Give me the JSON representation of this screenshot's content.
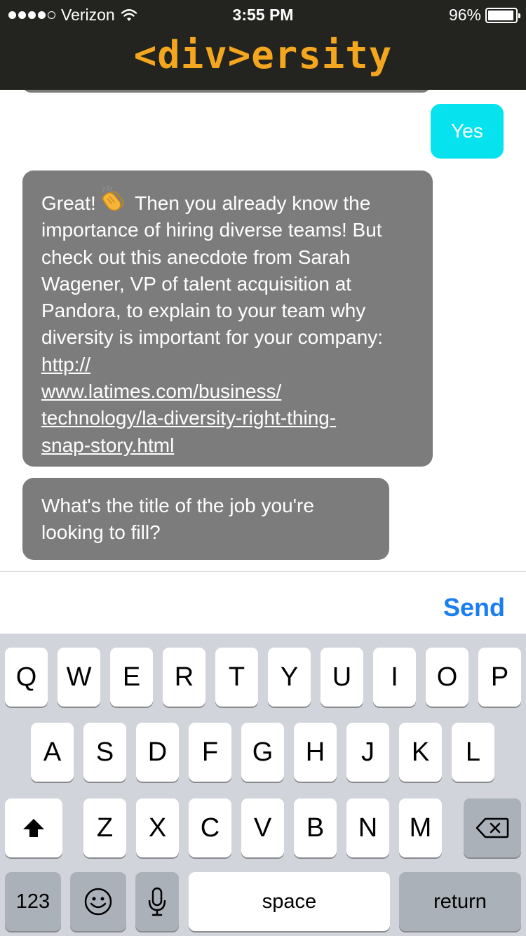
{
  "status_bar": {
    "carrier": "Verizon",
    "time": "3:55 PM",
    "battery": "96%",
    "battery_level": 0.96
  },
  "header": {
    "brand": "<div>ersity"
  },
  "chat": {
    "messages": [
      {
        "sender": "user",
        "text": "Yes"
      },
      {
        "sender": "bot",
        "text_before": "Great!",
        "emoji": "clapping-hands",
        "text_after": " Then you already know the importance of hiring diverse teams! But check out this anecdote from Sarah Wagener, VP of talent acquisition at Pandora, to explain to your team why diversity is important for your company: ",
        "link_lines": [
          "http://",
          "www.latimes.com/business/",
          "technology/la-diversity-right-thing-",
          "snap-story.html"
        ]
      },
      {
        "sender": "bot",
        "text": "What's the title of the job you're looking to fill?"
      }
    ]
  },
  "input": {
    "send_label": "Send"
  },
  "keyboard": {
    "row1": [
      "Q",
      "W",
      "E",
      "R",
      "T",
      "Y",
      "U",
      "I",
      "O",
      "P"
    ],
    "row2": [
      "A",
      "S",
      "D",
      "F",
      "G",
      "H",
      "J",
      "K",
      "L"
    ],
    "row3": [
      "Z",
      "X",
      "C",
      "V",
      "B",
      "N",
      "M"
    ],
    "numbers_label": "123",
    "space_label": "space",
    "return_label": "return",
    "icons": [
      "shift-icon",
      "backspace-icon",
      "emoji-icon",
      "microphone-icon",
      "wifi-icon",
      "clapping-hands-icon"
    ]
  },
  "colors": {
    "header_bg": "#23231f",
    "brand": "#f4a71e",
    "user_bubble": "#06e3ee",
    "bot_bubble": "#7c7c7c",
    "send": "#1a7df0",
    "keyboard_bg": "#d1d5db"
  }
}
